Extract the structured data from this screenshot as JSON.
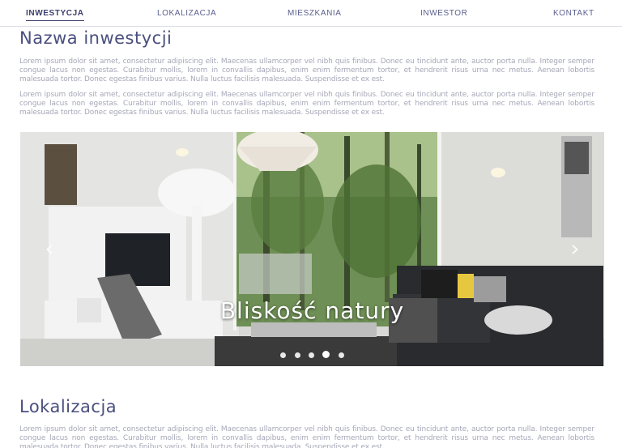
{
  "nav": {
    "items": [
      {
        "label": "INWESTYCJA",
        "active": true
      },
      {
        "label": "LOKALIZACJA",
        "active": false
      },
      {
        "label": "MIESZKANIA",
        "active": false
      },
      {
        "label": "INWESTOR",
        "active": false
      },
      {
        "label": "KONTAKT",
        "active": false
      }
    ]
  },
  "investment": {
    "title": "Nazwa inwestycji",
    "paragraphs": [
      "Lorem ipsum dolor sit amet, consectetur adipiscing elit. Maecenas ullamcorper vel nibh quis finibus. Donec eu tincidunt ante, auctor porta nulla. Integer semper congue lacus non egestas. Curabitur mollis, lorem in convallis dapibus, enim enim fermentum tortor, et hendrerit risus urna nec metus. Aenean lobortis malesuada tortor. Donec egestas finibus varius. Nulla luctus facilisis malesuada. Suspendisse et ex est.",
      "Lorem ipsum dolor sit amet, consectetur adipiscing elit. Maecenas ullamcorper vel nibh quis finibus. Donec eu tincidunt ante, auctor porta nulla. Integer semper congue lacus non egestas. Curabitur mollis, lorem in convallis dapibus, enim enim fermentum tortor, et hendrerit risus urna nec metus. Aenean lobortis malesuada tortor. Donec egestas finibus varius. Nulla luctus facilisis malesuada. Suspendisse et ex est."
    ]
  },
  "slider": {
    "caption": "Bliskość natury",
    "prev_icon": "‹",
    "next_icon": "›",
    "slide_count": 5,
    "active_index": 3
  },
  "location": {
    "title": "Lokalizacja",
    "paragraph": "Lorem ipsum dolor sit amet, consectetur adipiscing elit. Maecenas ullamcorper vel nibh quis finibus. Donec eu tincidunt ante, auctor porta nulla. Integer semper congue lacus non egestas. Curabitur mollis, lorem in convallis dapibus, enim enim fermentum tortor, et hendrerit risus urna nec metus. Aenean lobortis malesuada tortor. Donec egestas finibus varius. Nulla luctus facilisis malesuada. Suspendisse et ex est."
  },
  "colors": {
    "accent": "#4a4f7e",
    "nav_text": "#5a5f8e",
    "body_text": "#a6a8b8"
  }
}
